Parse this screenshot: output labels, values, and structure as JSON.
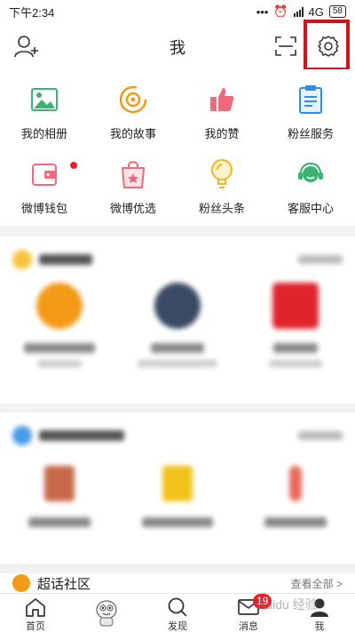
{
  "status": {
    "time": "下午2:34",
    "network": "4G",
    "battery": "58"
  },
  "header": {
    "title": "我"
  },
  "grid": [
    {
      "label": "我的相册",
      "icon": "photo-album-icon"
    },
    {
      "label": "我的故事",
      "icon": "story-icon"
    },
    {
      "label": "我的赞",
      "icon": "thumbs-up-icon"
    },
    {
      "label": "粉丝服务",
      "icon": "clipboard-icon"
    },
    {
      "label": "微博钱包",
      "icon": "wallet-icon"
    },
    {
      "label": "微博优选",
      "icon": "shopping-bag-icon"
    },
    {
      "label": "粉丝头条",
      "icon": "lightbulb-icon"
    },
    {
      "label": "客服中心",
      "icon": "headset-icon"
    }
  ],
  "topic": {
    "title": "超话社区",
    "more": "查看全部 >"
  },
  "tabs": [
    {
      "label": "首页",
      "icon": "home-icon"
    },
    {
      "label": "",
      "icon": "mascot-icon"
    },
    {
      "label": "发现",
      "icon": "search-icon"
    },
    {
      "label": "消息",
      "icon": "message-icon",
      "badge": "19"
    },
    {
      "label": "我",
      "icon": "profile-icon"
    }
  ],
  "watermark": "Baidu 经验",
  "colors": {
    "highlight": "#d0141a",
    "badge": "#e8202a",
    "accent": "#f39a17"
  }
}
